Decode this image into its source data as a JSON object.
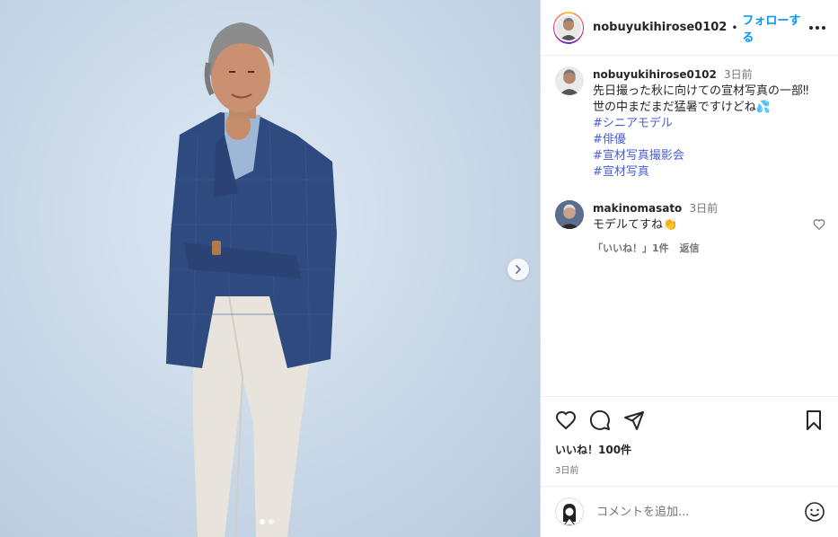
{
  "post": {
    "username": "nobuyukihirose0102",
    "follow_label": "フォローする",
    "separator": "•",
    "more_icon": "more-horizontal-icon"
  },
  "caption": {
    "username": "nobuyukihirose0102",
    "time": "3日前",
    "line1": "先日撮った秋に向けての宣材写真の一部‼︎",
    "line2": "世の中まだまだ猛暑ですけどね💦",
    "hashtags": [
      "#シニアモデル",
      "#俳優",
      "#宣材写真撮影会",
      "#宣材写真"
    ]
  },
  "reply": {
    "username": "makinomasato",
    "time": "3日前",
    "text": "モデルてすね👏",
    "likes_label": "「いいね！」1件",
    "reply_label": "返信"
  },
  "actions": {
    "likes": "いいね！100件",
    "date": "3日前"
  },
  "composer": {
    "placeholder": "コメントを追加...",
    "emoji_icon": "smiley-icon"
  },
  "carousel": {
    "slides": 2,
    "active_index": 0
  },
  "colors": {
    "link": "#0095f6",
    "hashtag": "#4a5dd4",
    "muted": "#737373"
  }
}
